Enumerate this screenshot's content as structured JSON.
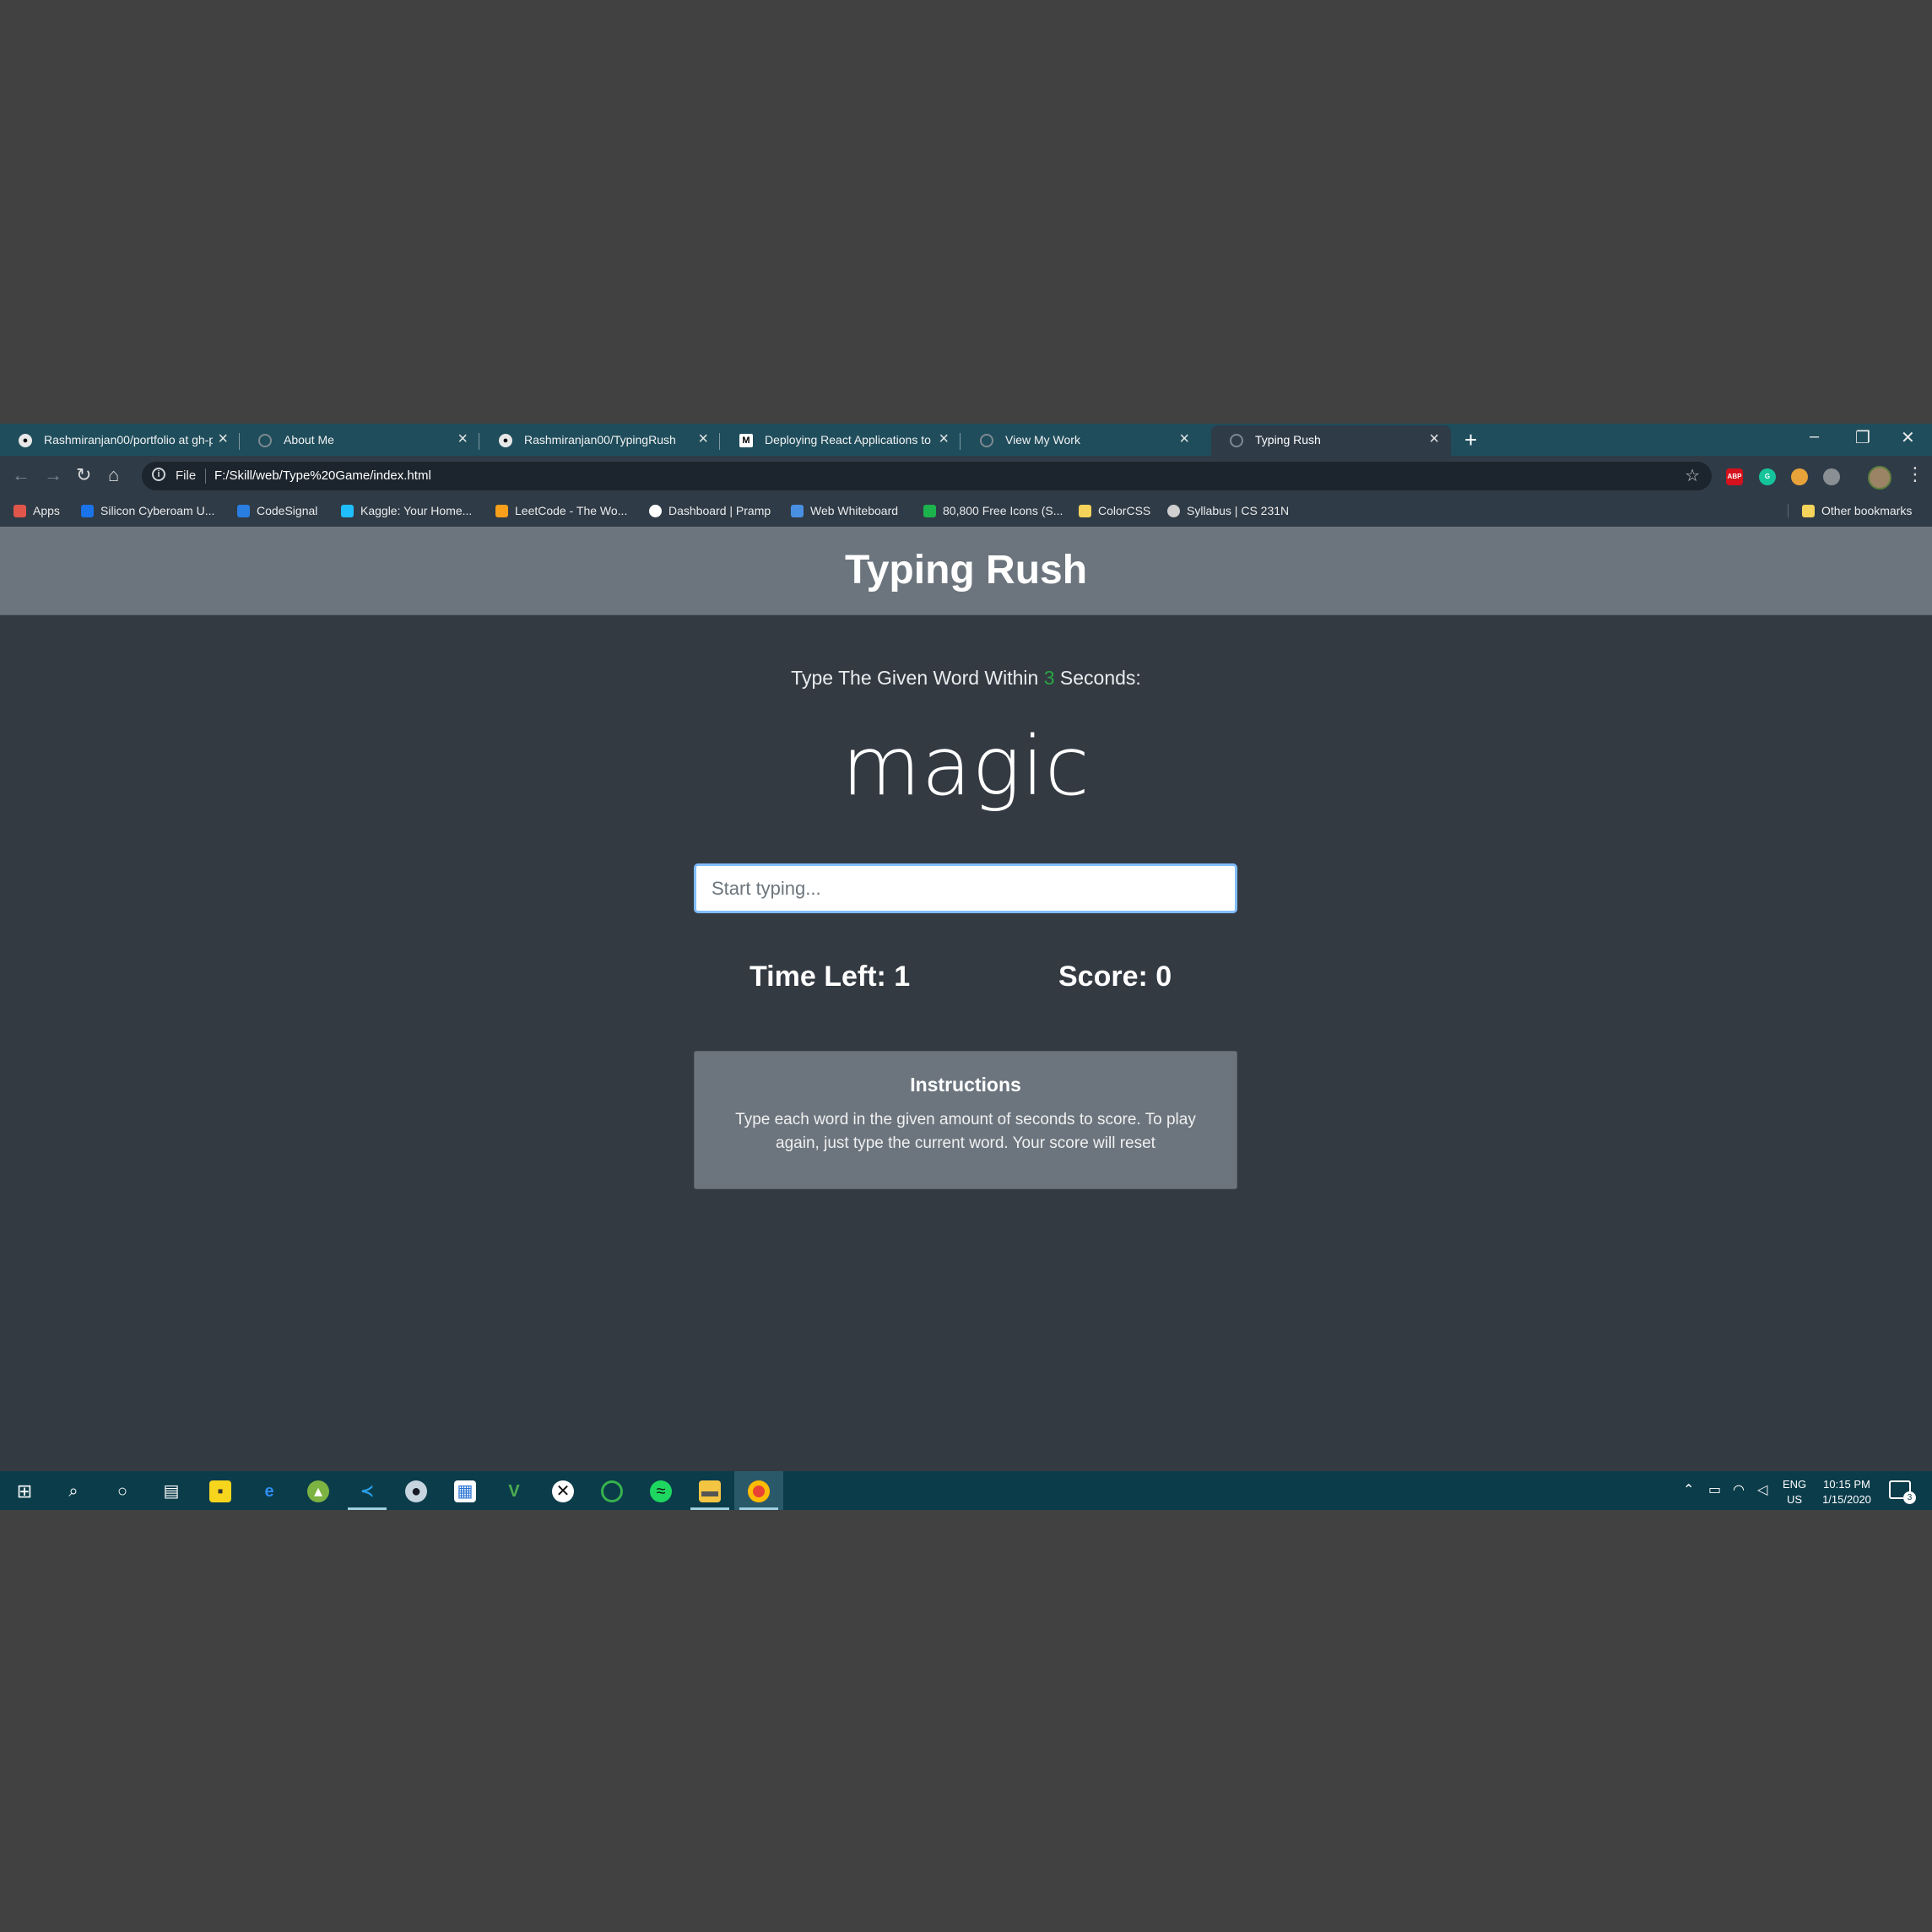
{
  "browser": {
    "tabs": [
      {
        "title": "Rashmiranjan00/portfolio at gh-p",
        "icon": "github-icon",
        "active": false
      },
      {
        "title": "About Me",
        "icon": "globe-icon",
        "active": false
      },
      {
        "title": "Rashmiranjan00/TypingRush",
        "icon": "github-icon",
        "active": false
      },
      {
        "title": "Deploying React Applications to",
        "icon": "medium-icon",
        "active": false
      },
      {
        "title": "View My Work",
        "icon": "globe-icon",
        "active": false
      },
      {
        "title": "Typing Rush",
        "icon": "globe-icon",
        "active": true
      }
    ],
    "new_tab": "+",
    "url_scheme_label": "File",
    "url": "F:/Skill/web/Type%20Game/index.html",
    "extensions": [
      {
        "label": "ABP",
        "color": "#d4111c"
      },
      {
        "label": "G",
        "color": "#15c39a"
      },
      {
        "label": "",
        "color": "#e8a23a"
      },
      {
        "label": "",
        "color": "#8a8f94"
      }
    ],
    "bookmarks": [
      {
        "label": "Apps",
        "icon_color": "#e0564b"
      },
      {
        "label": "Silicon Cyberoam U...",
        "icon_color": "#1a73e8"
      },
      {
        "label": "CodeSignal",
        "icon_color": "#2a7de1"
      },
      {
        "label": "Kaggle: Your Home...",
        "icon_color": "#20beff"
      },
      {
        "label": "LeetCode - The Wo...",
        "icon_color": "#f89f1b"
      },
      {
        "label": "Dashboard | Pramp",
        "icon_color": "#ffffff"
      },
      {
        "label": "Web Whiteboard",
        "icon_color": "#4a90e2"
      },
      {
        "label": "80,800 Free Icons (S...",
        "icon_color": "#1cb34c"
      },
      {
        "label": "ColorCSS",
        "icon_color": "#f6d35a"
      },
      {
        "label": "Syllabus | CS 231N",
        "icon_color": "#d0d0d0"
      }
    ],
    "other_bookmarks": "Other bookmarks",
    "other_bookmarks_icon_color": "#f6d35a"
  },
  "page": {
    "title": "Typing Rush",
    "prompt_before": "Type The Given Word Within ",
    "seconds": "3",
    "prompt_after": " Seconds:",
    "current_word": "magic",
    "input_placeholder": "Start typing...",
    "input_value": "",
    "time_left_label": "Time Left: ",
    "time_left": "1",
    "score_label": "Score: ",
    "score": "0",
    "instructions_heading": "Instructions",
    "instructions_body": "Type each word in the given amount of seconds to score. To play again, just type the current word. Your score will reset"
  },
  "colors": {
    "header_bg": "#6c757e",
    "page_bg": "#343a42",
    "accent_seconds": "#28a745",
    "input_focus": "#80bdff",
    "tabstrip": "#1f4d5c",
    "taskbar": "#0b3c4a"
  },
  "taskbar": {
    "apps": [
      "windows-start-icon",
      "search-icon",
      "cortana-icon",
      "task-view-icon",
      "sticky-notes-icon",
      "edge-icon",
      "android-studio-icon",
      "vscode-icon",
      "steam-icon",
      "store-icon",
      "vim-icon",
      "xbox-icon",
      "circle-app-icon",
      "spotify-icon",
      "file-explorer-icon",
      "chrome-icon"
    ],
    "language": "ENG",
    "region": "US",
    "time": "10:15 PM",
    "date": "1/15/2020",
    "notification_count": "3"
  }
}
